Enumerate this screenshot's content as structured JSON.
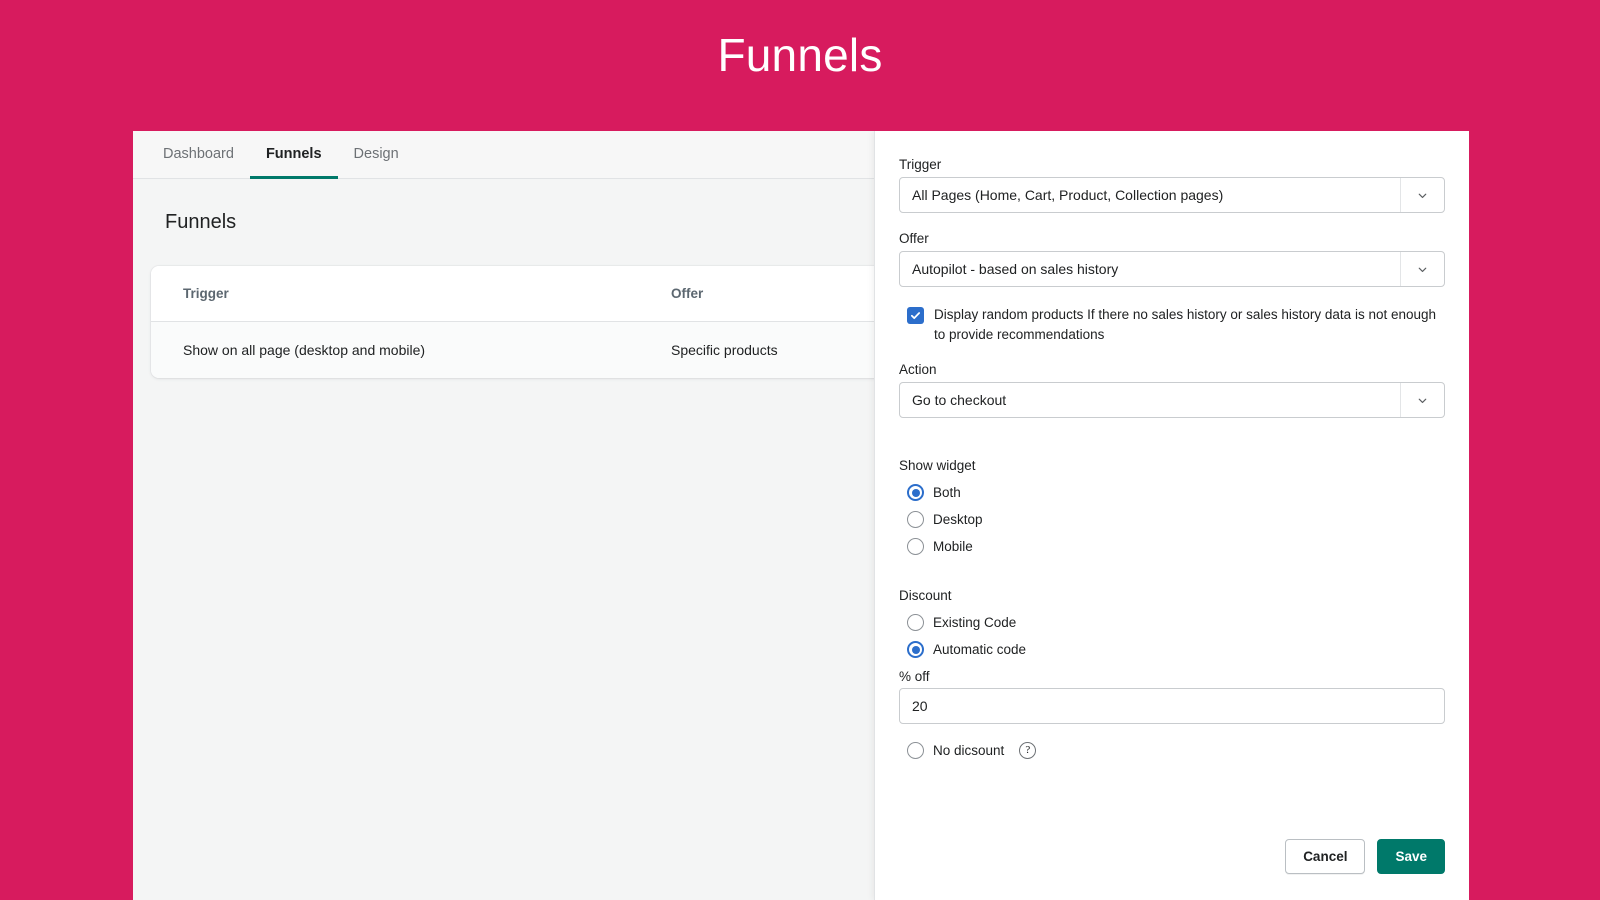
{
  "page": {
    "title": "Funnels",
    "background_color": "#d71b5e"
  },
  "tabs": [
    {
      "label": "Dashboard",
      "active": false
    },
    {
      "label": "Funnels",
      "active": true
    },
    {
      "label": "Design",
      "active": false
    }
  ],
  "main": {
    "heading": "Funnels",
    "table": {
      "columns": [
        "Trigger",
        "Offer"
      ],
      "rows": [
        {
          "trigger": "Show on all page (desktop and mobile)",
          "offer": "Specific products"
        }
      ]
    }
  },
  "panel": {
    "trigger": {
      "label": "Trigger",
      "value": "All Pages (Home, Cart, Product, Collection pages)"
    },
    "offer": {
      "label": "Offer",
      "value": "Autopilot - based on sales history"
    },
    "random_products": {
      "checked": true,
      "text": "Display random products If there no sales history or sales history data is not enough to provide recommendations"
    },
    "action": {
      "label": "Action",
      "value": "Go to checkout"
    },
    "show_widget": {
      "label": "Show widget",
      "options": [
        {
          "label": "Both",
          "selected": true
        },
        {
          "label": "Desktop",
          "selected": false
        },
        {
          "label": "Mobile",
          "selected": false
        }
      ]
    },
    "discount": {
      "label": "Discount",
      "options": [
        {
          "label": "Existing Code",
          "selected": false
        },
        {
          "label": "Automatic code",
          "selected": true
        }
      ],
      "percent_off_label": "% off",
      "percent_off_value": "20",
      "no_discount_label": "No dicsount",
      "no_discount_selected": false,
      "help_icon_glyph": "?"
    },
    "actions": {
      "cancel_label": "Cancel",
      "save_label": "Save",
      "save_color": "#00796a"
    }
  }
}
